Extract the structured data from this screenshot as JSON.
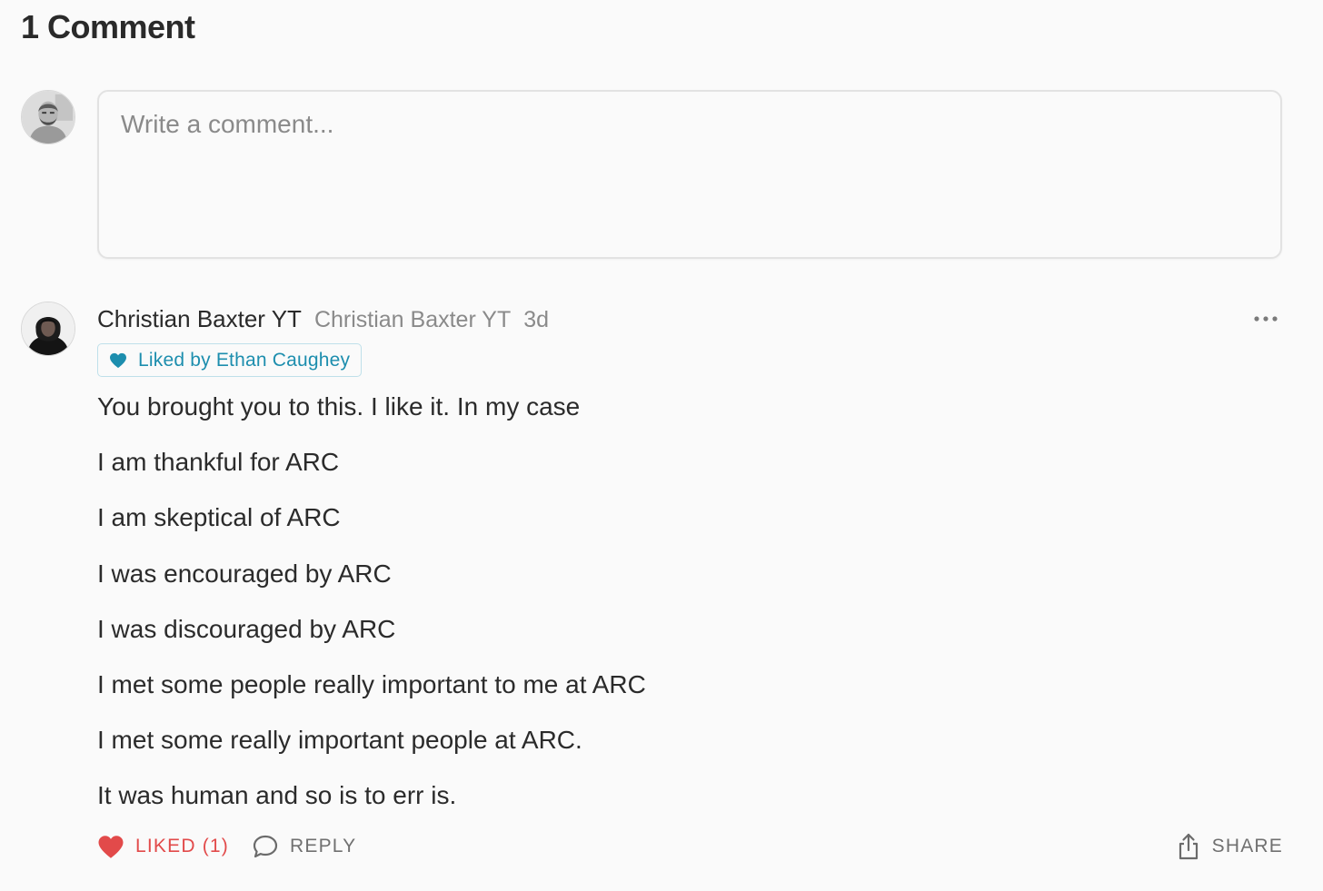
{
  "section": {
    "title": "1 Comment"
  },
  "composer": {
    "placeholder": "Write a comment...",
    "value": ""
  },
  "comment": {
    "author_name": "Christian Baxter YT",
    "author_handle": "Christian Baxter YT",
    "time": "3d",
    "liked_by": "Liked by Ethan Caughey",
    "lines": [
      "You brought you to this. I like it. In my case",
      "I am thankful for ARC",
      "I am skeptical of ARC",
      "I was encouraged by ARC",
      "I was discouraged by ARC",
      "I met some people really important to me at ARC",
      "I met some really important people at ARC.",
      "It was human and so is to err is."
    ],
    "actions": {
      "liked_label": "LIKED (1)",
      "reply_label": "REPLY",
      "share_label": "SHARE"
    }
  },
  "icons": {
    "current_user_avatar": "user-avatar",
    "author_avatar": "author-avatar",
    "more": "ellipsis-icon",
    "liked_by": "heart-icon",
    "like": "heart-icon",
    "reply": "speech-bubble-icon",
    "share": "share-icon"
  },
  "colors": {
    "background": "#fafafa",
    "text": "#2b2b2b",
    "muted": "#8a8a8a",
    "liked_red": "#e24a4a",
    "badge_blue": "#1d8eae",
    "badge_border": "#bfe0ea"
  }
}
